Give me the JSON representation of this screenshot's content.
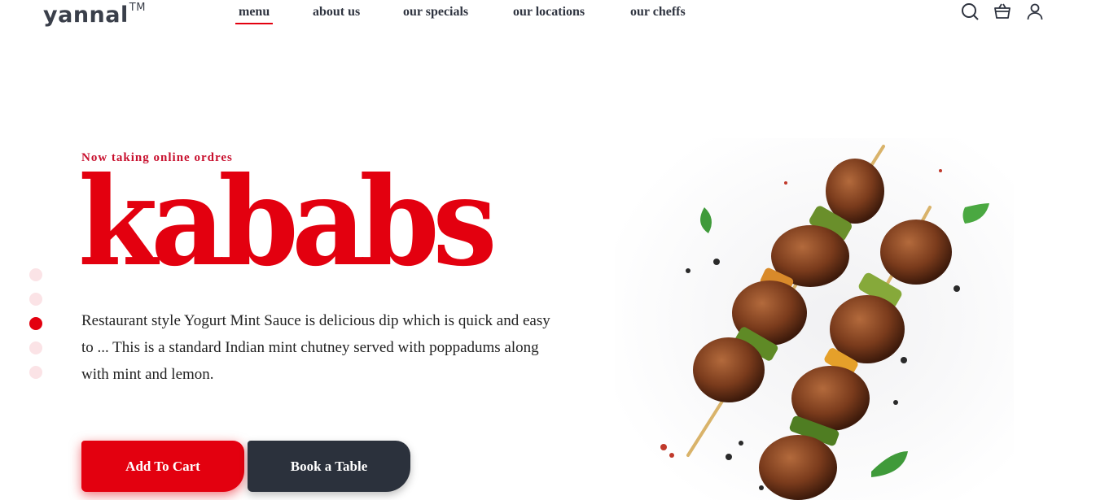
{
  "brand": {
    "name": "yannal",
    "tm": "TM"
  },
  "nav": {
    "items": [
      {
        "label": "menu",
        "active": true
      },
      {
        "label": "about us"
      },
      {
        "label": "our specials"
      },
      {
        "label": "our locations"
      },
      {
        "label": "our cheffs"
      }
    ]
  },
  "header_icons": [
    "search-icon",
    "shopping-bag-icon",
    "user-icon"
  ],
  "hero": {
    "eyebrow": "Now taking online ordres",
    "title": "kababs",
    "description": "Restaurant style Yogurt Mint Sauce is delicious dip which is quick and easy to ... This is a standard Indian mint chutney served with poppadums along with mint and lemon.",
    "buttons": {
      "add_to_cart": "Add To Cart",
      "book_table": "Book a Table"
    }
  },
  "slider": {
    "count": 5,
    "active_index": 3
  },
  "colors": {
    "accent": "#e3000f",
    "dark": "#2b313c",
    "dot_inactive": "#fbe3e6"
  }
}
